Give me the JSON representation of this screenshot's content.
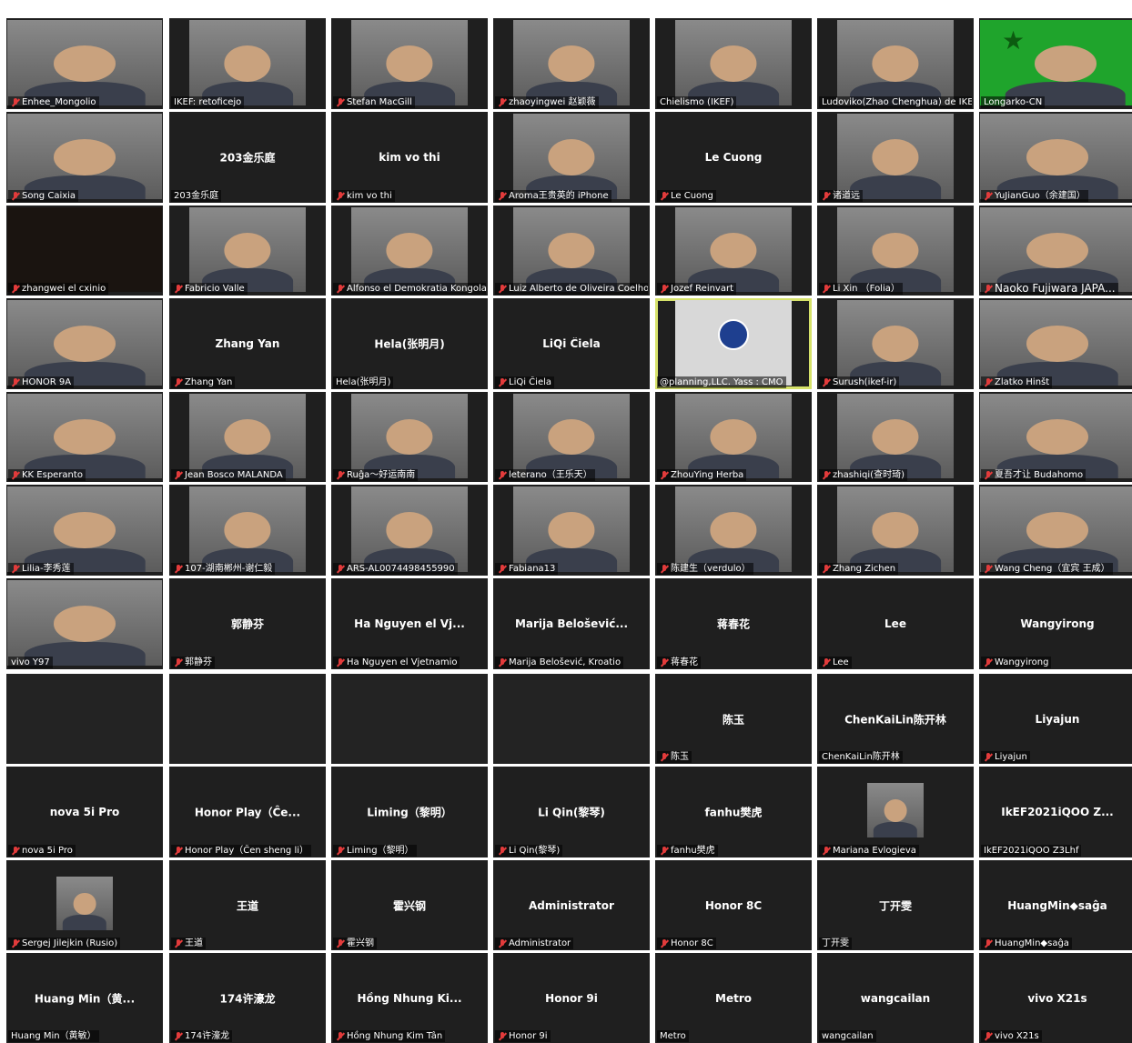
{
  "window": {
    "background": "#ffffff",
    "tile_background": "#1f1f1f",
    "active_speaker_border": "#d6e26a",
    "muted_mic_color": "#e23b3b"
  },
  "tiles": [
    {
      "name": "Enhee_Mongolio",
      "muted": true,
      "video": true
    },
    {
      "name": "IKEF: retoficejo",
      "muted": false,
      "video": true
    },
    {
      "name": "Stefan MacGill",
      "muted": true,
      "video": true
    },
    {
      "name": "zhaoyingwei 赵颖薇",
      "muted": true,
      "video": true
    },
    {
      "name": "Chielismo (IKEF)",
      "muted": false,
      "video": true
    },
    {
      "name": "Ludoviko(Zhao Chenghua) de IKEF",
      "muted": false,
      "video": true
    },
    {
      "name": "Longarko-CN",
      "muted": false,
      "video": true,
      "video_bg": "#1fa42c"
    },
    {
      "name": "Song Caixia",
      "muted": true,
      "video": true
    },
    {
      "name": "203金乐庭",
      "center": "203金乐庭",
      "muted": false,
      "video": false
    },
    {
      "name": "kim vo thi",
      "center": "kim vo thi",
      "muted": true,
      "video": false
    },
    {
      "name": "Aroma王贵英的 iPhone",
      "muted": true,
      "video": true
    },
    {
      "name": "Le Cuong",
      "center": "Le Cuong",
      "muted": true,
      "video": false
    },
    {
      "name": "诸道远",
      "muted": true,
      "video": true
    },
    {
      "name": "YuJianGuo（余建国）",
      "muted": true,
      "video": true
    },
    {
      "name": "zhangwei el cxinio",
      "muted": true,
      "video": true,
      "video_bg": "#1a1410"
    },
    {
      "name": "Fabricio Valle",
      "muted": true,
      "video": true
    },
    {
      "name": "Alfonso el Demokratia Kongolan...",
      "muted": true,
      "video": true
    },
    {
      "name": "Luiz Alberto de Oliveira Coelho",
      "muted": true,
      "video": true
    },
    {
      "name": "Jozef Reinvart",
      "muted": true,
      "video": true
    },
    {
      "name": "Li Xin （Folia）",
      "muted": true,
      "video": true
    },
    {
      "name": "Naoko Fujiwara JAPA...",
      "muted": true,
      "video": true,
      "large_tag": true
    },
    {
      "name": "HONOR 9A",
      "muted": true,
      "video": true
    },
    {
      "name": "Zhang Yan",
      "center": "Zhang Yan",
      "muted": true,
      "video": false
    },
    {
      "name": "Hela(张明月)",
      "center": "Hela(张明月)",
      "muted": false,
      "video": false
    },
    {
      "name": "LiQi Ĉiela",
      "center": "LiQi Ĉiela",
      "muted": true,
      "video": false
    },
    {
      "name": "@planning,LLC.   Yass : CMO",
      "muted": false,
      "video": true,
      "active": true,
      "partner": true
    },
    {
      "name": "Surush(ikef-ir)",
      "muted": true,
      "video": true
    },
    {
      "name": "Zlatko Hinšt",
      "muted": true,
      "video": true
    },
    {
      "name": "KK Esperanto",
      "muted": true,
      "video": true
    },
    {
      "name": "Jean Bosco MALANDA",
      "muted": true,
      "video": true
    },
    {
      "name": "Ruĝa～好运南南",
      "muted": true,
      "video": true
    },
    {
      "name": "leterano（王乐天）",
      "muted": true,
      "video": true
    },
    {
      "name": "ZhouYing Herba",
      "muted": true,
      "video": true
    },
    {
      "name": "zhashiqi(查时琦)",
      "muted": true,
      "video": true
    },
    {
      "name": "夏吾才让 Budahomo",
      "muted": true,
      "video": true
    },
    {
      "name": "Lilia-李秀莲",
      "muted": true,
      "video": true
    },
    {
      "name": "107-湖南郴州-谢仁毅",
      "muted": true,
      "video": true
    },
    {
      "name": "ARS-AL0074498455990",
      "muted": true,
      "video": true
    },
    {
      "name": "Fabiana13",
      "muted": true,
      "video": true
    },
    {
      "name": "陈建生（verdulo）",
      "muted": true,
      "video": true
    },
    {
      "name": "Zhang Zichen",
      "muted": true,
      "video": true
    },
    {
      "name": "Wang Cheng（宜宾 王成）",
      "muted": true,
      "video": true
    },
    {
      "name": "vivo Y97",
      "muted": false,
      "video": true
    },
    {
      "name": "郭静芬",
      "center": "郭静芬",
      "muted": true,
      "video": false
    },
    {
      "name": "Ha Nguyen el Vjetnamio",
      "center": "Ha Nguyen el Vj...",
      "muted": true,
      "video": false
    },
    {
      "name": "Marija Belošević, Kroatio",
      "center": "Marija Belošević...",
      "muted": true,
      "video": false
    },
    {
      "name": "蒋春花",
      "center": "蒋春花",
      "muted": true,
      "video": false
    },
    {
      "name": "Lee",
      "center": "Lee",
      "muted": true,
      "video": false
    },
    {
      "name": "Wangyirong",
      "center": "Wangyirong",
      "muted": true,
      "video": false
    },
    {
      "empty": true
    },
    {
      "empty": true
    },
    {
      "empty": true
    },
    {
      "empty": true
    },
    {
      "name": "陈玉",
      "center": "陈玉",
      "muted": true,
      "video": false
    },
    {
      "name": "ChenKaiLin陈开林",
      "center": "ChenKaiLin陈开林",
      "muted": false,
      "video": false
    },
    {
      "name": "Liyajun",
      "center": "Liyajun",
      "muted": true,
      "video": false
    },
    {
      "name": "nova 5i Pro",
      "center": "nova 5i Pro",
      "muted": true,
      "video": false
    },
    {
      "name": "Honor Play（Ĉen sheng li）",
      "center": "Honor Play（Ĉe...",
      "muted": true,
      "video": false
    },
    {
      "name": "Liming（黎明）",
      "center": "Liming（黎明）",
      "muted": true,
      "video": false
    },
    {
      "name": "Li Qin(黎琴)",
      "center": "Li Qin(黎琴)",
      "muted": true,
      "video": false
    },
    {
      "name": "fanhu樊虎",
      "center": "fanhu樊虎",
      "muted": true,
      "video": false
    },
    {
      "name": "Mariana Evlogieva",
      "muted": true,
      "video": true,
      "small_photo": true
    },
    {
      "name": "IkEF2021iQOO Z3Lhf",
      "center": "IkEF2021iQOO Z...",
      "muted": false,
      "video": false
    },
    {
      "name": "Sergej Jilejkin (Rusio)",
      "muted": true,
      "video": true,
      "small_photo": true
    },
    {
      "name": "王道",
      "center": "王道",
      "muted": true,
      "video": false
    },
    {
      "name": "霍兴钢",
      "center": "霍兴钢",
      "muted": true,
      "video": false
    },
    {
      "name": "Administrator",
      "center": "Administrator",
      "muted": true,
      "video": false
    },
    {
      "name": "Honor 8C",
      "center": "Honor 8C",
      "muted": true,
      "video": false
    },
    {
      "name": "丁开雯",
      "center": "丁开雯",
      "muted": false,
      "video": false
    },
    {
      "name": "HuangMin◆saĝa",
      "center": "HuangMin◆saĝa",
      "muted": true,
      "video": false
    },
    {
      "name": "Huang Min（黄敏）",
      "center": "Huang Min（黄...",
      "muted": false,
      "video": false
    },
    {
      "name": "174许濠龙",
      "center": "174许濠龙",
      "muted": true,
      "video": false
    },
    {
      "name": "Hồng Nhung Kim Tân",
      "center": "Hồng Nhung Ki...",
      "muted": true,
      "video": false
    },
    {
      "name": "Honor 9i",
      "center": "Honor 9i",
      "muted": true,
      "video": false
    },
    {
      "name": "Metro",
      "center": "Metro",
      "muted": false,
      "video": false
    },
    {
      "name": "wangcailan",
      "center": "wangcailan",
      "muted": false,
      "video": false
    },
    {
      "name": "vivo X21s",
      "center": "vivo X21s",
      "muted": true,
      "video": false
    }
  ]
}
